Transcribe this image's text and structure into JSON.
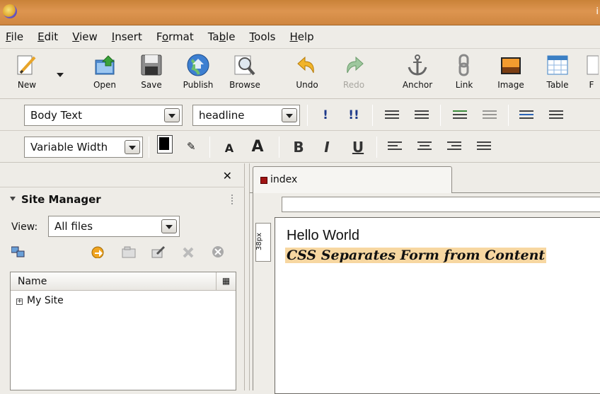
{
  "window": {
    "title": "i"
  },
  "menu": [
    {
      "label": "File",
      "mn": "F",
      "rest": "ile"
    },
    {
      "label": "Edit",
      "mn": "E",
      "rest": "dit"
    },
    {
      "label": "View",
      "mn": "V",
      "rest": "iew"
    },
    {
      "label": "Insert",
      "mn": "I",
      "rest": "nsert"
    },
    {
      "label": "Format",
      "mn": "o",
      "pre": "F",
      "rest": "rmat"
    },
    {
      "label": "Table",
      "mn": "b",
      "pre": "Ta",
      "rest": "le"
    },
    {
      "label": "Tools",
      "mn": "T",
      "rest": "ools"
    },
    {
      "label": "Help",
      "mn": "H",
      "rest": "elp"
    }
  ],
  "toolbar": {
    "new": "New",
    "open": "Open",
    "save": "Save",
    "publish": "Publish",
    "browse": "Browse",
    "undo": "Undo",
    "redo": "Redo",
    "anchor": "Anchor",
    "link": "Link",
    "image": "Image",
    "table": "Table",
    "form": "F"
  },
  "format": {
    "paragraph_style": "Body Text",
    "css_class": "headline",
    "font": "Variable Width",
    "text_color": "#000000",
    "bold": "B",
    "italic": "I",
    "underline": "U",
    "font_smaller": "A",
    "font_larger": "A",
    "strong": "!",
    "em": "!!"
  },
  "site_manager": {
    "title": "Site Manager",
    "view_label": "View:",
    "view_value": "All files",
    "column_name": "Name",
    "items": [
      "My Site"
    ]
  },
  "editor": {
    "tab": "index",
    "ruler": "38px",
    "heading": "Hello World",
    "subheading": "CSS Separates Form from Content"
  }
}
